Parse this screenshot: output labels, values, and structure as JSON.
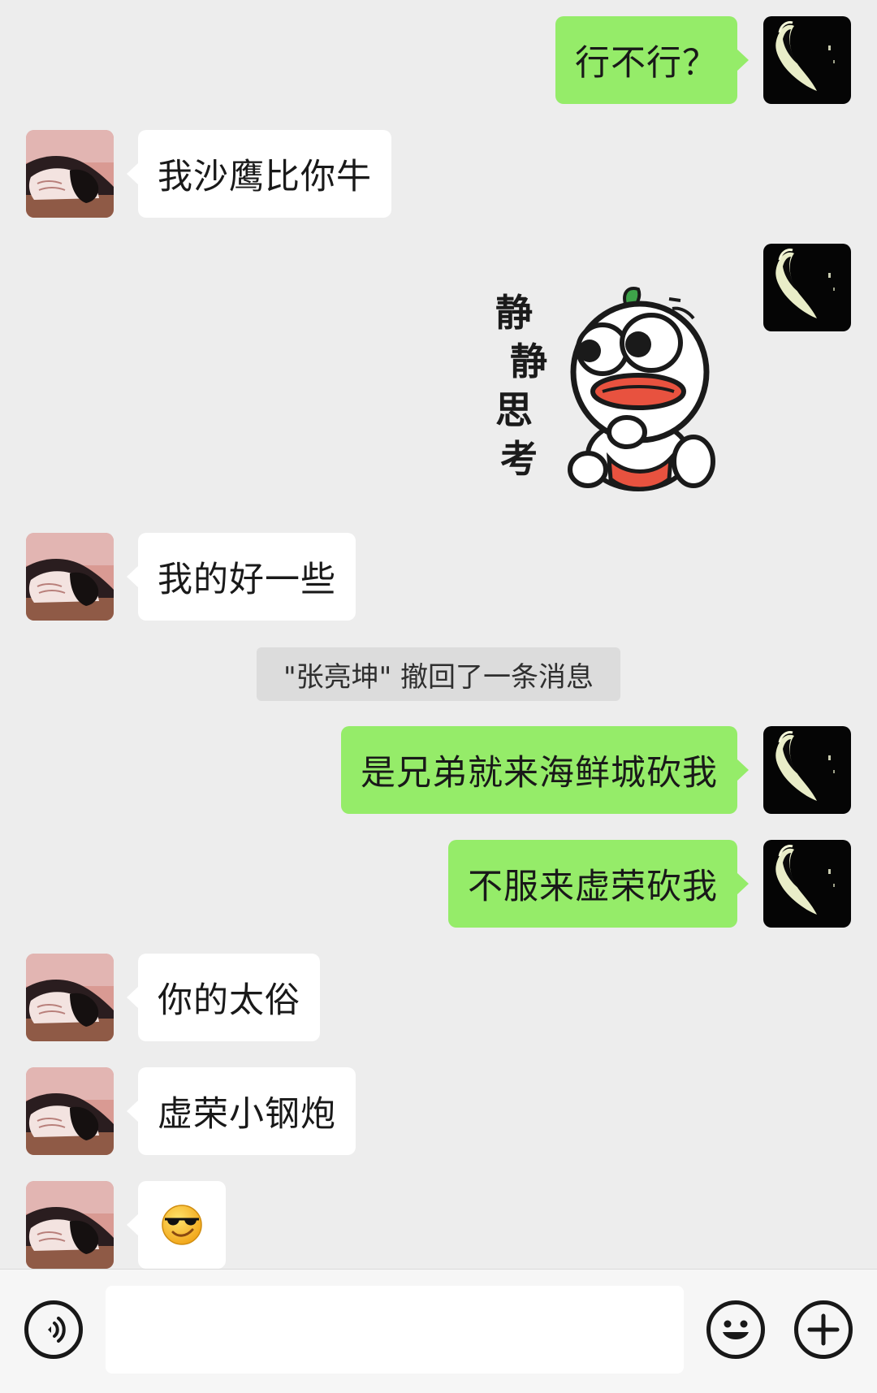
{
  "messages": [
    {
      "sender": "me",
      "type": "text",
      "text": "行不行？"
    },
    {
      "sender": "other",
      "type": "text",
      "text": "我沙鹰比你牛"
    },
    {
      "sender": "me",
      "type": "sticker",
      "sticker_text": [
        "静",
        "静",
        "思",
        "考"
      ]
    },
    {
      "sender": "other",
      "type": "text",
      "text": "我的好一些"
    },
    {
      "type": "system",
      "text": "\"张亮坤\" 撤回了一条消息"
    },
    {
      "sender": "me",
      "type": "text",
      "text": "是兄弟就来海鲜城砍我"
    },
    {
      "sender": "me",
      "type": "text",
      "text": "不服来虚荣砍我"
    },
    {
      "sender": "other",
      "type": "text",
      "text": "你的太俗"
    },
    {
      "sender": "other",
      "type": "text",
      "text": "虚荣小钢炮"
    },
    {
      "sender": "other",
      "type": "emoji",
      "icon": "sunglasses-smiley-icon"
    }
  ],
  "input_bar": {
    "voice_icon": "voice-icon",
    "emoji_icon": "emoji-icon",
    "plus_icon": "plus-icon",
    "input_value": ""
  },
  "colors": {
    "background": "#ededed",
    "my_bubble": "#95ec69",
    "other_bubble": "#ffffff",
    "system_notice": "#dcdcdc",
    "input_bar": "#f6f6f6"
  }
}
